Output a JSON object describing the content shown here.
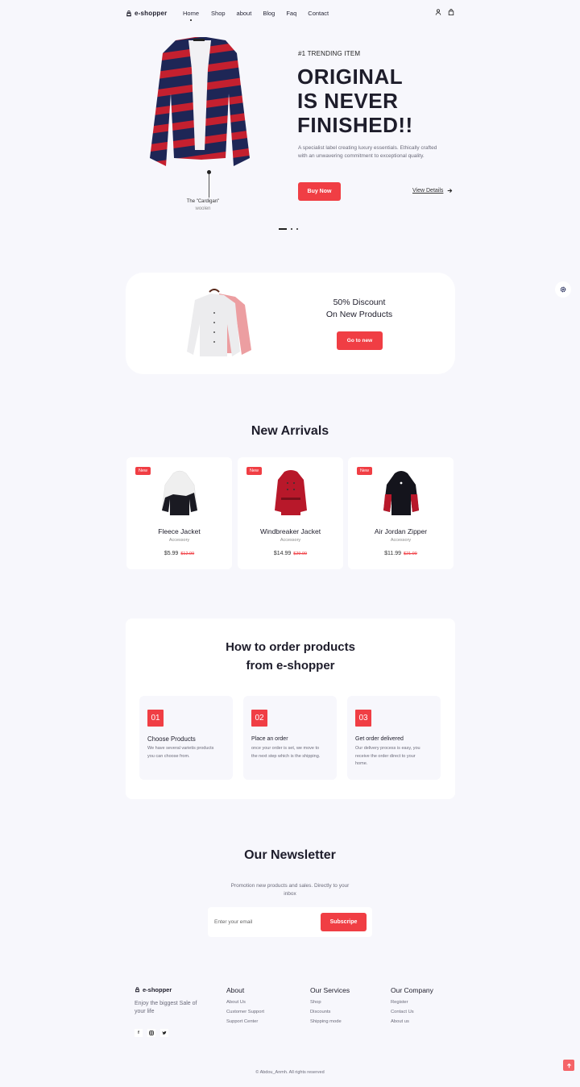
{
  "brand": {
    "name": "e-shopper",
    "accent": "#f03e44"
  },
  "nav": {
    "items": [
      {
        "label": "Home",
        "active": true
      },
      {
        "label": "Shop",
        "active": false
      },
      {
        "label": "about",
        "active": false
      },
      {
        "label": "Blog",
        "active": false
      },
      {
        "label": "Faq",
        "active": false
      },
      {
        "label": "Contact",
        "active": false
      }
    ],
    "icons": [
      "user-icon",
      "shopping-bag-icon"
    ]
  },
  "hero": {
    "eyebrow": "#1 TRENDING ITEM",
    "title_lines": [
      "ORIGINAL",
      "IS NEVER",
      "FINISHED!!"
    ],
    "description": "A specialist label creating luxury essentials. Ethically crafted with an unwavering commitment to exceptional quality.",
    "buy_label": "Buy Now",
    "details_label": "View Details",
    "product_name": "The \"Cardigan\"",
    "product_material": "woolen",
    "slides": 3,
    "active_slide": 1
  },
  "discount": {
    "line1": "50% Discount",
    "line2": "On New Products",
    "button": "Go to new"
  },
  "arrivals": {
    "title": "New Arrivals",
    "products": [
      {
        "badge": "New",
        "name": "Fleece Jacket",
        "category": "Accessory",
        "price": "$5.99",
        "old_price": "$12.99"
      },
      {
        "badge": "New",
        "name": "Windbreaker Jacket",
        "category": "Accessory",
        "price": "$14.99",
        "old_price": "$29.99"
      },
      {
        "badge": "New",
        "name": "Air Jordan Zipper",
        "category": "Accessory",
        "price": "$11.99",
        "old_price": "$21.99"
      }
    ]
  },
  "how_to_order": {
    "title_line1": "How to order products",
    "title_line2": "from e-shopper",
    "steps": [
      {
        "num": "01",
        "title": "Choose Products",
        "desc": "We have several varietis products you can choose from."
      },
      {
        "num": "02",
        "title": "Place an order",
        "desc": "once your order is set, we move to the next step which is the shipping."
      },
      {
        "num": "03",
        "title": "Get order delivered",
        "desc": "Our delivery process is easy, you receive the order direct to your home."
      }
    ]
  },
  "newsletter": {
    "title": "Our Newsletter",
    "desc": "Promotion new products and sales. Directly to your inbox",
    "placeholder": "Enter your email",
    "value": "",
    "button": "Subscripe"
  },
  "footer": {
    "brand": "e-shopper",
    "tagline": "Enjoy the biggest Sale of your life",
    "socials": [
      "facebook-icon",
      "instagram-icon",
      "twitter-icon"
    ],
    "columns": [
      {
        "title": "About",
        "links": [
          "About Us",
          "Customer Support",
          "Support Center"
        ]
      },
      {
        "title": "Our Services",
        "links": [
          "Shop",
          "Discounts",
          "Shipping mode"
        ]
      },
      {
        "title": "Our Company",
        "links": [
          "Register",
          "Contact Us",
          "About us"
        ]
      }
    ],
    "copyright": "© Abdou_Anmh. All rights reserved"
  }
}
